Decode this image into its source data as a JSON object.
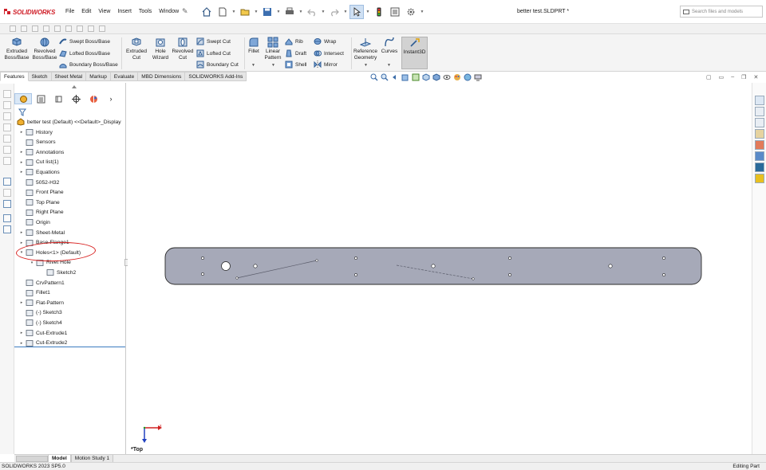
{
  "app": {
    "logo_brand": "SOLIDWORKS",
    "document_title": "better test.SLDPRT *"
  },
  "menu": [
    "File",
    "Edit",
    "View",
    "Insert",
    "Tools",
    "Window"
  ],
  "search": {
    "placeholder": "Search files and models"
  },
  "command_manager": {
    "extruded_boss": "Extruded Boss/Base",
    "revolved_boss": "Revolved Boss/Base",
    "swept_boss": "Swept Boss/Base",
    "lofted_boss": "Lofted Boss/Base",
    "boundary_boss": "Boundary Boss/Base",
    "extruded_cut": "Extruded Cut",
    "hole_wizard": "Hole Wizard",
    "revolved_cut": "Revolved Cut",
    "swept_cut": "Swept Cut",
    "lofted_cut": "Lofted Cut",
    "boundary_cut": "Boundary Cut",
    "fillet": "Fillet",
    "linear_pattern": "Linear Pattern",
    "rib": "Rib",
    "draft": "Draft",
    "shell": "Shell",
    "wrap": "Wrap",
    "intersect": "Intersect",
    "mirror": "Mirror",
    "reference_geometry": "Reference Geometry",
    "curves": "Curves",
    "instant3d": "Instant3D"
  },
  "tabs": [
    "Features",
    "Sketch",
    "Sheet Metal",
    "Markup",
    "Evaluate",
    "MBD Dimensions",
    "SOLIDWORKS Add-Ins"
  ],
  "tree": {
    "root": "better test (Default) <<Default>_Display",
    "items": [
      {
        "label": "History",
        "icon": "history-icon",
        "expand": "▸"
      },
      {
        "label": "Sensors",
        "icon": "sensor-icon",
        "expand": ""
      },
      {
        "label": "Annotations",
        "icon": "annotation-icon",
        "expand": "▸"
      },
      {
        "label": "Cut list(1)",
        "icon": "cutlist-icon",
        "expand": "▸"
      },
      {
        "label": "Equations",
        "icon": "equation-icon",
        "expand": "▸"
      },
      {
        "label": "5052-H32",
        "icon": "material-icon",
        "expand": ""
      },
      {
        "label": "Front Plane",
        "icon": "plane-icon",
        "expand": ""
      },
      {
        "label": "Top Plane",
        "icon": "plane-icon",
        "expand": ""
      },
      {
        "label": "Right Plane",
        "icon": "plane-icon",
        "expand": ""
      },
      {
        "label": "Origin",
        "icon": "origin-icon",
        "expand": ""
      },
      {
        "label": "Sheet-Metal",
        "icon": "sheetmetal-icon",
        "expand": "▸"
      },
      {
        "label": "Base-Flange1",
        "icon": "flange-icon",
        "expand": "▸"
      },
      {
        "label": "Holes<1> (Default)",
        "icon": "library-feature-icon",
        "expand": "▾"
      },
      {
        "label": "Rivet Hole",
        "icon": "hole-feature-icon",
        "expand": "▾"
      },
      {
        "label": "Sketch2",
        "icon": "sketch-icon",
        "expand": ""
      },
      {
        "label": "CrvPattern1",
        "icon": "curve-pattern-icon",
        "expand": ""
      },
      {
        "label": "Fillet1",
        "icon": "fillet-icon",
        "expand": ""
      },
      {
        "label": "Flat-Pattern",
        "icon": "flat-pattern-icon",
        "expand": "▸"
      },
      {
        "label": "(-) Sketch3",
        "icon": "sketch-icon",
        "expand": ""
      },
      {
        "label": "(-) Sketch4",
        "icon": "sketch-icon",
        "expand": ""
      },
      {
        "label": "Cut-Extrude1",
        "icon": "cut-extrude-icon",
        "expand": "▸"
      },
      {
        "label": "Cut-Extrude2",
        "icon": "cut-extrude-icon",
        "expand": "▸"
      }
    ]
  },
  "viewport": {
    "view_name": "*Top",
    "triad_x": "x",
    "part_color": "#a6a9b8"
  },
  "bottom_tabs": [
    "Model",
    "Motion Study 1"
  ],
  "status": {
    "left": "SOLIDWORKS 2023 SP5.0",
    "right": "Editing Part"
  }
}
